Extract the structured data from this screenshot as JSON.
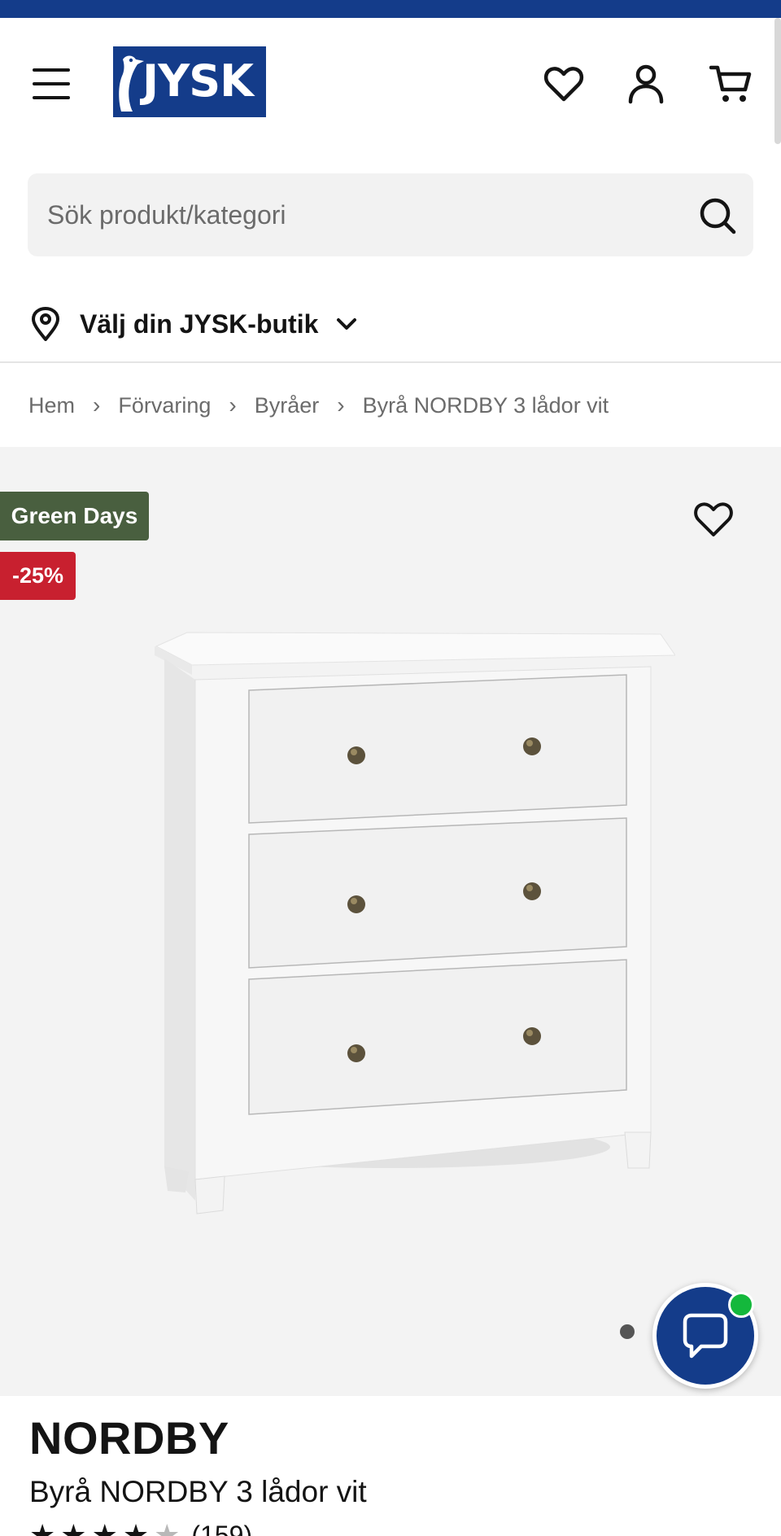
{
  "header": {
    "logo_text": "JYSK",
    "brand_color": "#143c8a",
    "icons": [
      "menu-icon",
      "heart-icon",
      "user-icon",
      "cart-icon"
    ]
  },
  "search": {
    "placeholder": "Sök produkt/kategori"
  },
  "store": {
    "label": "Välj din JYSK-butik"
  },
  "breadcrumb": {
    "items": [
      "Hem",
      "Förvaring",
      "Byråer",
      "Byrå NORDBY 3 lådor vit"
    ],
    "separator": "›"
  },
  "gallery": {
    "badge_campaign": "Green Days",
    "badge_campaign_color": "#495f3f",
    "badge_discount": "-25%",
    "badge_discount_color": "#c8202f",
    "image_subject": "white 3-drawer chest with bronze knobs"
  },
  "product": {
    "brand": "NORDBY",
    "name": "Byrå NORDBY 3 lådor vit",
    "rating": 4,
    "rating_max": 5,
    "review_count": "(159)"
  },
  "chat": {
    "status_color": "#14b83c"
  }
}
